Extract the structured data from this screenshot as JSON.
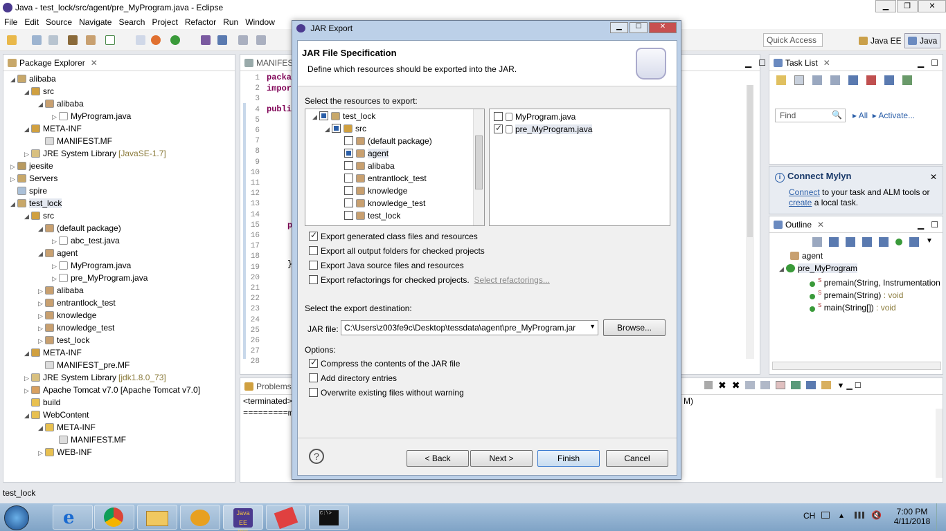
{
  "window": {
    "title": "Java - test_lock/src/agent/pre_MyProgram.java - Eclipse"
  },
  "menu": [
    "File",
    "Edit",
    "Source",
    "Navigate",
    "Search",
    "Project",
    "Refactor",
    "Run",
    "Window"
  ],
  "toolbar": {
    "quick_access": "Quick Access",
    "perspective_javaee": "Java EE",
    "perspective_java": "Java"
  },
  "package_explorer": {
    "title": "Package Explorer",
    "rows": [
      "alibaba",
      "src",
      "alibaba",
      "MyProgram.java",
      "META-INF",
      "MANIFEST.MF",
      "JRE System Library",
      "jeesite",
      "Servers",
      "spire",
      "test_lock",
      "src",
      "(default package)",
      "abc_test.java",
      "agent",
      "MyProgram.java",
      "pre_MyProgram.java",
      "alibaba",
      "entrantlock_test",
      "knowledge",
      "knowledge_test",
      "test_lock",
      "META-INF",
      "MANIFEST_pre.MF",
      "JRE System Library",
      "Apache Tomcat v7.0 [Apache Tomcat v7.0]",
      "build",
      "WebContent",
      "META-INF",
      "MANIFEST.MF",
      "WEB-INF"
    ],
    "jre1_suffix": "[JavaSE-1.7]",
    "jre2_suffix": "[jdk1.8.0_73]"
  },
  "editor": {
    "tab": "MANIFES",
    "lines": [
      "1",
      "2",
      "3",
      "4",
      "5",
      "6",
      "7",
      "8",
      "9",
      "10",
      "11",
      "12",
      "13",
      "14",
      "15",
      "16",
      "17",
      "18",
      "19",
      "20",
      "21",
      "22",
      "23",
      "24",
      "25",
      "26",
      "27",
      "28"
    ],
    "code": [
      "packa",
      "impor",
      "publi",
      "p",
      "}"
    ]
  },
  "console": {
    "tab": "Problems",
    "terminated": "<terminated>",
    "line": "=========m",
    "right_fragment": "M)"
  },
  "task_list": {
    "title": "Task List",
    "find": "Find",
    "all": "All",
    "activate": "Activate..."
  },
  "mylyn": {
    "title": "Connect Mylyn",
    "connect": "Connect",
    "text1": " to your task and ALM tools or",
    "create": "create",
    "text2": " a local task."
  },
  "outline": {
    "title": "Outline",
    "items": [
      "agent",
      "pre_MyProgram",
      "premain(String, Instrumentation",
      "premain(String)",
      "main(String[])"
    ],
    "void": " : void"
  },
  "status_bar": {
    "text": "test_lock"
  },
  "dialog": {
    "title": "JAR Export",
    "header": "JAR File Specification",
    "subheader": "Define which resources should be exported into the JAR.",
    "select_label": "Select the resources to export:",
    "tree": [
      "test_lock",
      "src",
      "(default package)",
      "agent",
      "alibaba",
      "entrantlock_test",
      "knowledge",
      "knowledge_test",
      "test_lock"
    ],
    "files": [
      "MyProgram.java",
      "pre_MyProgram.java"
    ],
    "opt1": "Export generated class files and resources",
    "opt2": "Export all output folders for checked projects",
    "opt3": "Export Java source files and resources",
    "opt4": "Export refactorings for checked projects.",
    "select_refactorings": "Select refactorings...",
    "dest_label": "Select the export destination:",
    "jar_file_label": "JAR file:",
    "jar_path": "C:\\Users\\z003fe9c\\Desktop\\tessdata\\agent\\pre_MyProgram.jar",
    "browse": "Browse...",
    "options_label": "Options:",
    "compress": "Compress the contents of the JAR file",
    "add_dir": "Add directory entries",
    "overwrite": "Overwrite existing files without warning",
    "back": "< Back",
    "next": "Next >",
    "finish": "Finish",
    "cancel": "Cancel"
  },
  "taskbar": {
    "lang": "CH",
    "time": "7:00 PM",
    "date": "4/11/2018"
  }
}
